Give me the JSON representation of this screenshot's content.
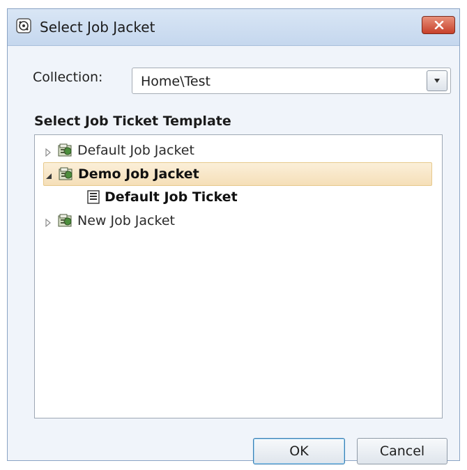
{
  "window": {
    "title": "Select Job Jacket"
  },
  "collection": {
    "label": "Collection:",
    "value": "Home\\Test"
  },
  "tree": {
    "header": "Select Job Ticket Template",
    "items": [
      {
        "label": "Default Job Jacket",
        "expanded": false
      },
      {
        "label": "Demo Job Jacket",
        "expanded": true,
        "selected": true
      },
      {
        "label": "Default Job Ticket",
        "child": true
      },
      {
        "label": "New Job Jacket",
        "expanded": false
      }
    ]
  },
  "buttons": {
    "ok": "OK",
    "cancel": "Cancel"
  },
  "icons": {
    "app": "job-jacket-app-icon",
    "close": "close-icon",
    "dropdown": "chevron-down-icon",
    "folder": "job-jacket-folder-icon",
    "ticket": "job-ticket-document-icon"
  }
}
